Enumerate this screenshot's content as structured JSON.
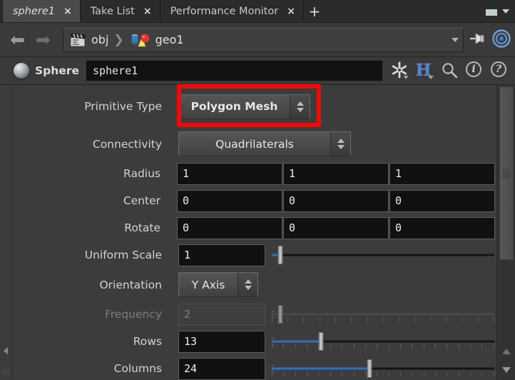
{
  "tabbar": {
    "tabs": [
      {
        "label": "sphere1",
        "close": "×",
        "active": true
      },
      {
        "label": "Take List",
        "close": "×",
        "active": false
      },
      {
        "label": "Performance Monitor",
        "close": "×",
        "active": false
      }
    ],
    "add_label": "+",
    "window_icon": "window-icon",
    "menu_arrow_icon": "chevron-down-icon"
  },
  "pathbar": {
    "back_icon": "⬅",
    "forward_icon": "➡",
    "crumbs": [
      {
        "icon": "clapperboard-icon",
        "label": "obj"
      },
      {
        "icon": "geometry-object-icon",
        "label": "geo1"
      }
    ],
    "separator": "❯",
    "dropdown_icon": "chevron-down-icon",
    "pin_icon": "pin-icon",
    "target_icon": "target-icon"
  },
  "node_header": {
    "type_icon": "sphere-icon",
    "type_label": "Sphere",
    "name_value": "sphere1",
    "icons": [
      {
        "name": "gear-icon",
        "glyph": "✹"
      },
      {
        "name": "houdini-h-icon",
        "glyph": "H"
      },
      {
        "name": "search-icon",
        "glyph": "⌕"
      },
      {
        "name": "info-icon",
        "glyph": "i"
      },
      {
        "name": "help-icon",
        "glyph": "?"
      }
    ]
  },
  "colors": {
    "accent_blue": "#2f6fc4",
    "annotation_red": "#f00a0a",
    "panel_bg": "#3c3c3c",
    "field_bg": "#111111"
  },
  "parameters": [
    {
      "label": "Primitive Type",
      "kind": "menu",
      "value": "Polygon Mesh",
      "bold": true,
      "highlighted": true,
      "disabled": false
    },
    {
      "label": "Connectivity",
      "kind": "menu",
      "value": "Quadrilaterals",
      "bold": false,
      "highlighted": false,
      "disabled": false
    },
    {
      "label": "Radius",
      "kind": "vector3",
      "values": [
        "1",
        "1",
        "1"
      ],
      "disabled": false
    },
    {
      "label": "Center",
      "kind": "vector3",
      "values": [
        "0",
        "0",
        "0"
      ],
      "disabled": false
    },
    {
      "label": "Rotate",
      "kind": "vector3",
      "values": [
        "0",
        "0",
        "0"
      ],
      "disabled": false
    },
    {
      "label": "Uniform Scale",
      "kind": "slider",
      "value": "1",
      "fill_percent": 4,
      "handle_percent": 4,
      "ticks": false,
      "disabled": false
    },
    {
      "label": "Orientation",
      "kind": "menu",
      "value": "Y Axis",
      "bold": false,
      "highlighted": false,
      "disabled": false
    },
    {
      "label": "Frequency",
      "kind": "slider",
      "value": "2",
      "fill_percent": 0,
      "handle_percent": 4,
      "ticks": true,
      "disabled": true
    },
    {
      "label": "Rows",
      "kind": "slider",
      "value": "13",
      "fill_percent": 22,
      "handle_percent": 22,
      "ticks": true,
      "disabled": false
    },
    {
      "label": "Columns",
      "kind": "slider",
      "value": "24",
      "fill_percent": 44,
      "handle_percent": 44,
      "ticks": true,
      "disabled": false
    }
  ],
  "scrollbar": {
    "thumb_name": "scroll-thumb",
    "up_icon": "scroll-up-arrow",
    "down_icon": "scroll-down-arrow"
  }
}
